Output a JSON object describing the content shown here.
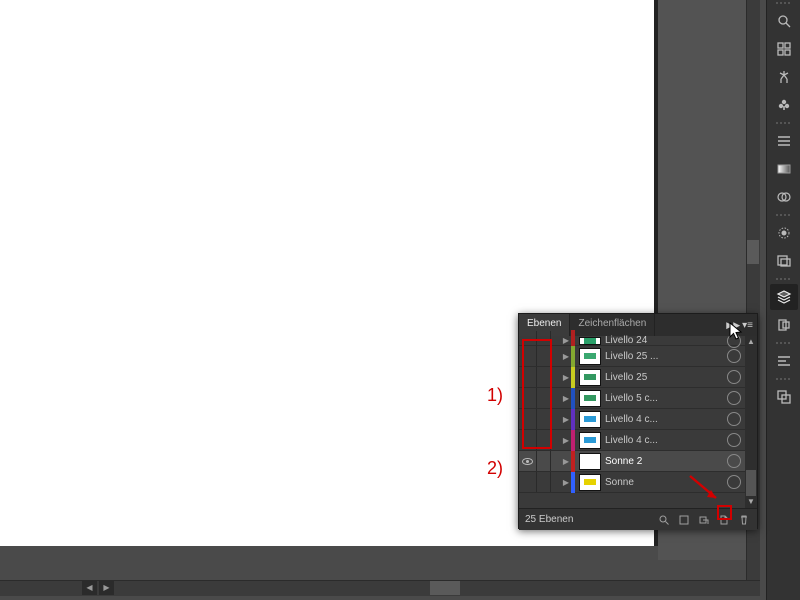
{
  "tabs": {
    "layers": "Ebenen",
    "artboards": "Zeichenflächen"
  },
  "layers": {
    "count_text": "25 Ebenen",
    "rows": [
      {
        "name": "Livello 24",
        "color": "#b02020",
        "selected": false,
        "visible": false,
        "thumb": "#2aa06a"
      },
      {
        "name": "Livello 25 ...",
        "color": "#84a830",
        "selected": false,
        "visible": false,
        "thumb": "#3aa870"
      },
      {
        "name": "Livello 25",
        "color": "#c7cc20",
        "selected": false,
        "visible": false,
        "thumb": "#329860"
      },
      {
        "name": "Livello 5 c...",
        "color": "#2050c0",
        "selected": false,
        "visible": false,
        "thumb": "#329860"
      },
      {
        "name": "Livello 4 c...",
        "color": "#6030c0",
        "selected": false,
        "visible": false,
        "thumb": "#2a9ad6"
      },
      {
        "name": "Livello 4 c...",
        "color": "#c02070",
        "selected": false,
        "visible": false,
        "thumb": "#2a9ad6"
      },
      {
        "name": "Sonne 2",
        "color": "#c02020",
        "selected": true,
        "visible": true,
        "thumb": "#ffffff"
      },
      {
        "name": "Sonne",
        "color": "#3060ff",
        "selected": false,
        "visible": false,
        "thumb": "#e6d200"
      }
    ]
  },
  "annotations": {
    "one": "1)",
    "two": "2)"
  },
  "icons": {
    "find": "find-icon",
    "grid": "grid-icon",
    "puppet": "puppet-icon",
    "club": "club-icon",
    "align": "align-icon",
    "gradient": "gradient-icon",
    "transparency": "transparency-icon",
    "appearance": "appearance-icon",
    "graphicstyles": "graphic-styles-icon",
    "layers": "layers-icon",
    "artboards": "artboards-icon",
    "symbols": "symbols-icon",
    "brushes": "brushes-icon"
  }
}
